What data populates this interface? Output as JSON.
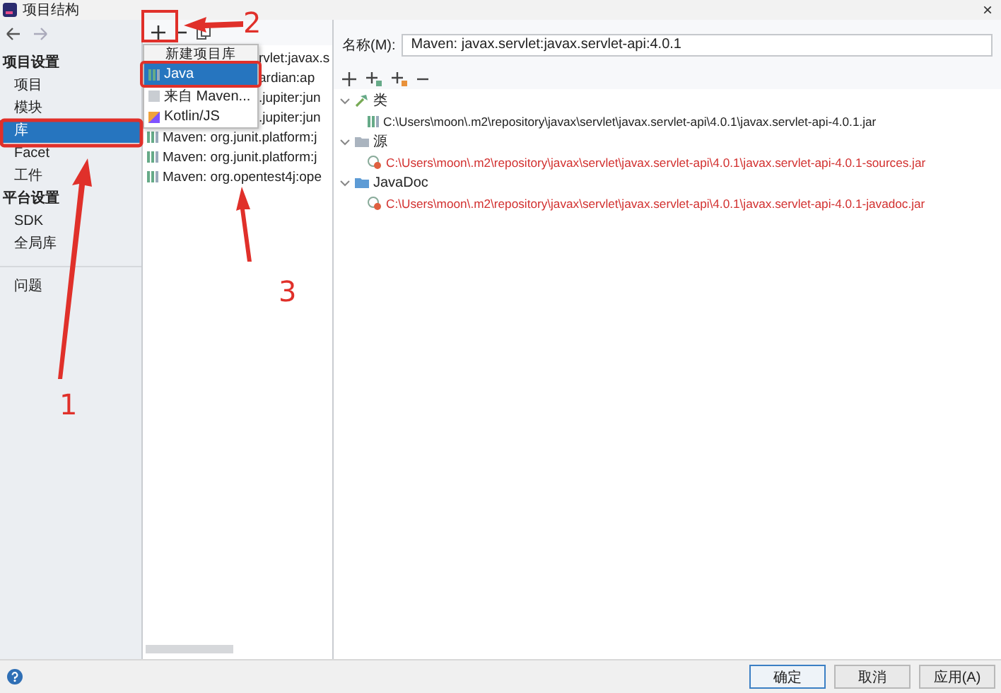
{
  "window": {
    "title": "项目结构",
    "close": "×"
  },
  "sidebar": {
    "sections": [
      {
        "heading": "项目设置",
        "items": [
          {
            "label": "项目",
            "selected": false
          },
          {
            "label": "模块",
            "selected": false
          },
          {
            "label": "库",
            "selected": true
          },
          {
            "label": "Facet",
            "selected": false
          },
          {
            "label": "工件",
            "selected": false
          }
        ]
      },
      {
        "heading": "平台设置",
        "items": [
          {
            "label": "SDK",
            "selected": false
          },
          {
            "label": "全局库",
            "selected": false
          }
        ]
      }
    ],
    "bottom_items": [
      {
        "label": "问题",
        "selected": false
      }
    ]
  },
  "library_list": {
    "rows": [
      {
        "text": "rvlet:javax.s",
        "kind": "partial"
      },
      {
        "text": "ardian:ap",
        "kind": "partial"
      },
      {
        "text": ".jupiter:jun",
        "kind": "partial"
      },
      {
        "text": ".jupiter:jun",
        "kind": "partial"
      },
      {
        "text": "Maven: org.junit.platform:j",
        "kind": "full"
      },
      {
        "text": "Maven: org.junit.platform:j",
        "kind": "full"
      },
      {
        "text": "Maven: org.opentest4j:ope",
        "kind": "full"
      }
    ]
  },
  "popup": {
    "title": "新建项目库",
    "items": [
      {
        "label": "Java",
        "kind": "java",
        "selected": true
      },
      {
        "label": "来自 Maven...",
        "kind": "maven",
        "selected": false
      },
      {
        "label": "Kotlin/JS",
        "kind": "kotlin",
        "selected": false
      }
    ]
  },
  "detail": {
    "name_label": "名称(M):",
    "name_value": "Maven: javax.servlet:javax.servlet-api:4.0.1",
    "tree": [
      {
        "label": "类",
        "kind": "classes",
        "expanded": true,
        "children": [
          {
            "label": "C:\\Users\\moon\\.m2\\repository\\javax\\servlet\\javax.servlet-api\\4.0.1\\javax.servlet-api-4.0.1.jar",
            "missing": false
          }
        ]
      },
      {
        "label": "源",
        "kind": "sources",
        "expanded": true,
        "children": [
          {
            "label": "C:\\Users\\moon\\.m2\\repository\\javax\\servlet\\javax.servlet-api\\4.0.1\\javax.servlet-api-4.0.1-sources.jar",
            "missing": true
          }
        ]
      },
      {
        "label": "JavaDoc",
        "kind": "javadoc",
        "expanded": true,
        "children": [
          {
            "label": "C:\\Users\\moon\\.m2\\repository\\javax\\servlet\\javax.servlet-api\\4.0.1\\javax.servlet-api-4.0.1-javadoc.jar",
            "missing": true
          }
        ]
      }
    ]
  },
  "buttons": [
    {
      "label": "确定",
      "default": true
    },
    {
      "label": "取消",
      "default": false
    },
    {
      "label": "应用(A)",
      "default": false
    }
  ],
  "annotations": [
    {
      "label": "1"
    },
    {
      "label": "2"
    },
    {
      "label": "3"
    }
  ]
}
